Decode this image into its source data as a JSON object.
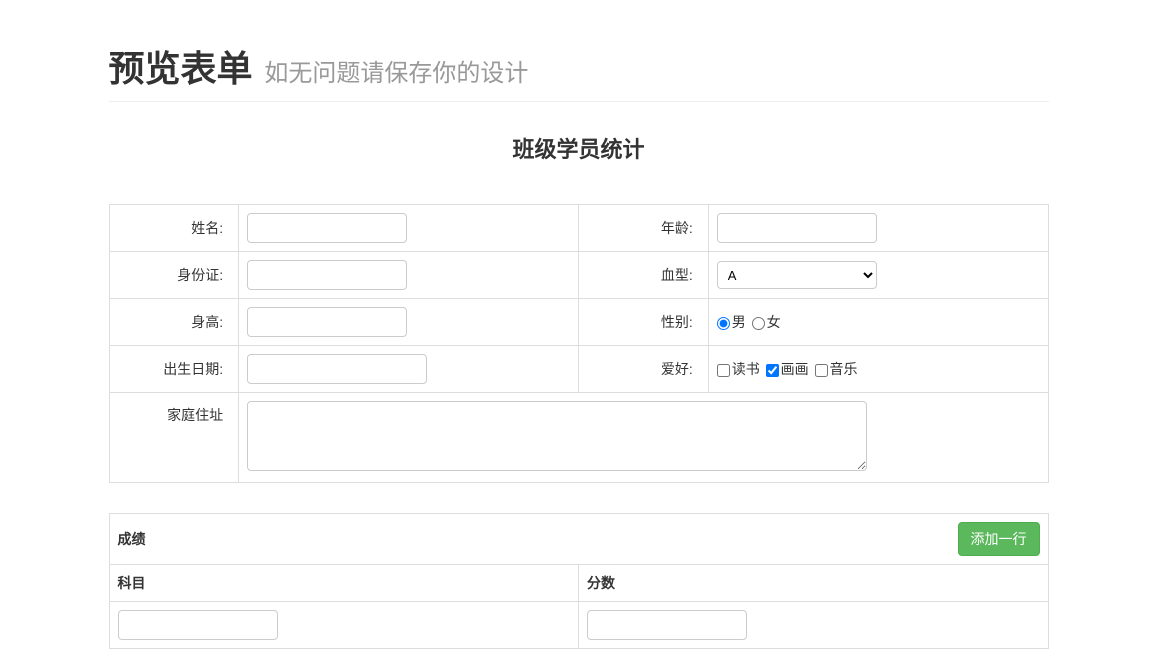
{
  "header": {
    "title": "预览表单",
    "subtitle": "如无问题请保存你的设计"
  },
  "form": {
    "title": "班级学员统计",
    "fields": {
      "name": {
        "label": "姓名:",
        "value": ""
      },
      "age": {
        "label": "年龄:",
        "value": ""
      },
      "idcard": {
        "label": "身份证:",
        "value": ""
      },
      "bloodtype": {
        "label": "血型:",
        "selected": "A",
        "options": [
          "A"
        ]
      },
      "height": {
        "label": "身高:",
        "value": ""
      },
      "gender": {
        "label": "性别:",
        "options": [
          "男",
          "女"
        ],
        "selected": "男"
      },
      "birthdate": {
        "label": "出生日期:",
        "value": ""
      },
      "hobby": {
        "label": "爱好:",
        "options": [
          "读书",
          "画画",
          "音乐"
        ],
        "checked": [
          "画画"
        ]
      },
      "address": {
        "label": "家庭住址",
        "value": ""
      }
    }
  },
  "grades": {
    "title": "成绩",
    "add_button": "添加一行",
    "columns": [
      "科目",
      "分数"
    ],
    "rows": [
      {
        "subject": "",
        "score": ""
      }
    ]
  }
}
